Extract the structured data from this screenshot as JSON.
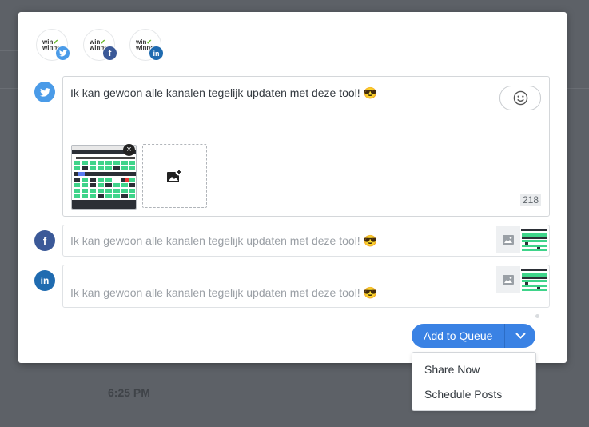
{
  "background": {
    "time_label": "6:25 PM"
  },
  "profiles": [
    {
      "network": "twitter",
      "logo_line1": "win",
      "logo_line2": "winner",
      "badge_icon": "twitter-bird",
      "badge_color": "#4a9be8"
    },
    {
      "network": "facebook",
      "logo_line1": "win",
      "logo_line2": "winner",
      "badge_text": "f",
      "badge_color": "#3b5998"
    },
    {
      "network": "linkedin",
      "logo_line1": "win",
      "logo_line2": "winner",
      "badge_text": "in",
      "badge_color": "#1f6bb0"
    }
  ],
  "composer": {
    "twitter": {
      "text": "Ik kan gewoon alle kanalen tegelijk updaten met deze tool! 😎",
      "char_count": "218",
      "emoji_button_icon": "smiley-icon",
      "remove_icon": "×"
    },
    "facebook": {
      "icon_text": "f",
      "text": "Ik kan gewoon alle kanalen tegelijk updaten met deze tool! 😎"
    },
    "linkedin": {
      "icon_text": "in",
      "text": "Ik kan gewoon alle kanalen tegelijk updaten met deze tool! 😎"
    }
  },
  "actions": {
    "primary_label": "Add to Queue",
    "dropdown_items": [
      "Share Now",
      "Schedule Posts"
    ]
  },
  "colors": {
    "accent": "#3a82e4",
    "twitter": "#4a9be8",
    "facebook": "#3b5998",
    "linkedin": "#1f6bb0"
  }
}
